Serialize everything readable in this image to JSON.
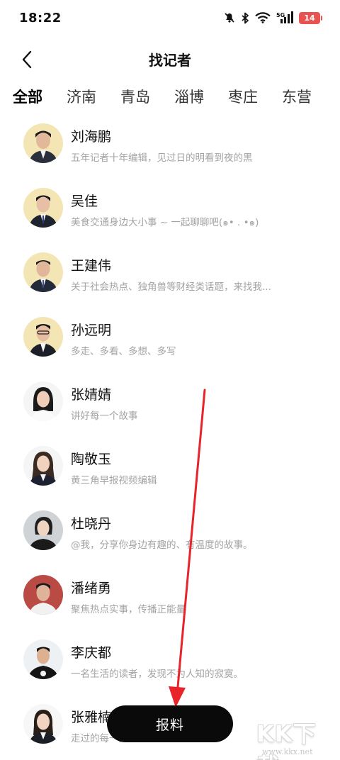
{
  "status_bar": {
    "time": "18:22",
    "battery": "14",
    "network": "5G",
    "icons": [
      "mute-icon",
      "bluetooth-icon",
      "wifi-icon",
      "signal-icon",
      "battery-icon"
    ]
  },
  "header": {
    "title": "找记者",
    "back_icon": "chevron-left-icon"
  },
  "tabs": [
    {
      "label": "全部",
      "active": true
    },
    {
      "label": "济南",
      "active": false
    },
    {
      "label": "青岛",
      "active": false
    },
    {
      "label": "淄博",
      "active": false
    },
    {
      "label": "枣庄",
      "active": false
    },
    {
      "label": "东营",
      "active": false
    }
  ],
  "reporters": [
    {
      "name": "刘海鹏",
      "desc": "五年记者十年编辑，见过日的明看到夜的黑"
    },
    {
      "name": "吴佳",
      "desc": "美食交通身边大小事 ~ 一起聊聊吧(๑• . •๑)"
    },
    {
      "name": "王建伟",
      "desc": "关于社会热点、独角兽等财经类话题，来找我..."
    },
    {
      "name": "孙远明",
      "desc": "多走、多看、多想、多写"
    },
    {
      "name": "张婧婧",
      "desc": "讲好每一个故事"
    },
    {
      "name": "陶敬玉",
      "desc": "黄三角早报视频编辑"
    },
    {
      "name": "杜晓丹",
      "desc": "@我，分享你身边有趣的、有温度的故事。"
    },
    {
      "name": "潘绪勇",
      "desc": "聚焦热点实事，传播正能量"
    },
    {
      "name": "李庆都",
      "desc": "一名生活的读者，发现不为人知的寂寞。"
    },
    {
      "name": "张雅楠",
      "desc": "走过的每一步"
    }
  ],
  "report_button": {
    "label": "报料"
  },
  "watermark": {
    "big": "KK下载",
    "small": "www.kkx.net"
  },
  "colors": {
    "accent_tab_gradient": [
      "#c9f2a7",
      "#a9efe2"
    ],
    "annotation_arrow": "#e8242a",
    "button_bg": "#0a0a0a"
  }
}
